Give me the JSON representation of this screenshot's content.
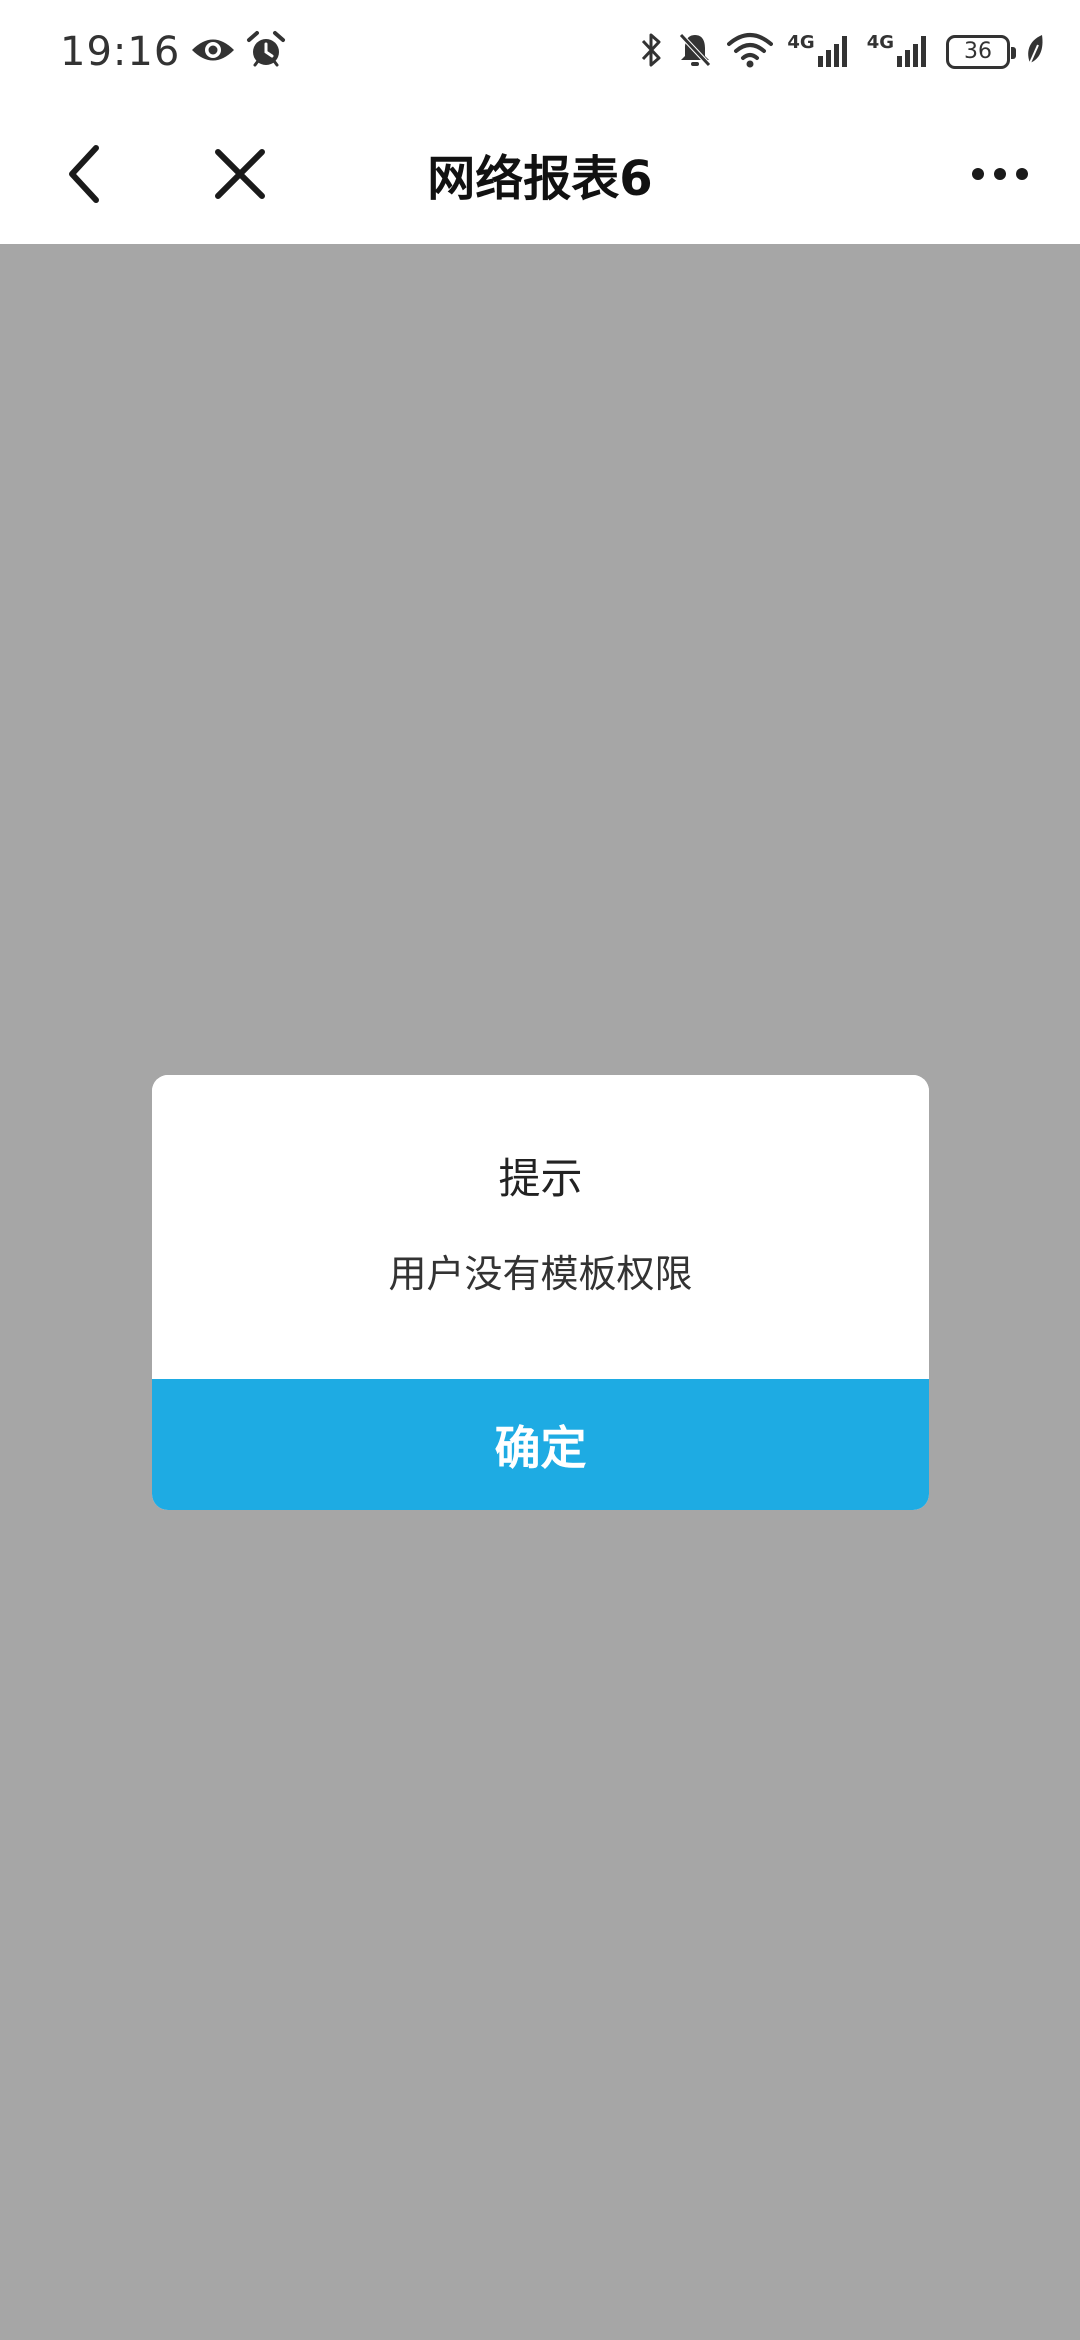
{
  "status_bar": {
    "time": "19:16",
    "battery": "36",
    "network_1": "4G",
    "network_2": "4G",
    "icons": [
      "eye-icon",
      "alarm-icon",
      "bluetooth-icon",
      "bell-muted-icon",
      "wifi-icon",
      "signal-icon",
      "signal-icon",
      "battery-icon",
      "leaf-icon"
    ]
  },
  "nav": {
    "title": "网络报表6",
    "icons": [
      "back-arrow-icon",
      "close-icon",
      "more-icon"
    ]
  },
  "dialog": {
    "title": "提示",
    "message": "用户没有模板权限",
    "confirm_label": "确定"
  },
  "colors": {
    "accent": "#1eabe3",
    "overlay": "#a6a6a6",
    "background": "#ffffff"
  }
}
